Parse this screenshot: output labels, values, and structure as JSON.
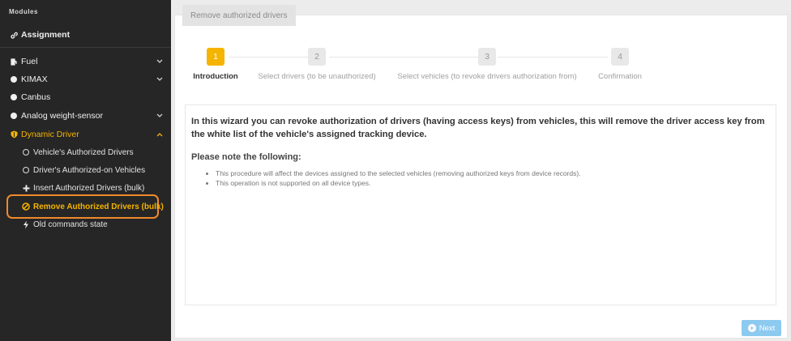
{
  "sidebar": {
    "header": "Modules",
    "assignment": "Assignment",
    "items": [
      {
        "label": "Fuel",
        "icon": "fuel-icon",
        "chevron": "down"
      },
      {
        "label": "KIMAX",
        "icon": "circle-icon",
        "chevron": "down"
      },
      {
        "label": "Canbus",
        "icon": "circle-icon"
      },
      {
        "label": "Analog weight-sensor",
        "icon": "circle-icon",
        "chevron": "down"
      },
      {
        "label": "Dynamic Driver",
        "icon": "shield-icon",
        "chevron": "up",
        "active": true
      }
    ],
    "subitems": [
      {
        "label": "Vehicle's Authorized Drivers",
        "icon": "ring-icon"
      },
      {
        "label": "Driver's Authorized-on Vehicles",
        "icon": "ring-icon"
      },
      {
        "label": "Insert Authorized Drivers (bulk)",
        "icon": "plus-icon"
      },
      {
        "label": "Remove Authorized Drivers (bulk)",
        "icon": "ban-icon",
        "highlighted": true
      },
      {
        "label": "Old commands state",
        "icon": "bolt-icon"
      }
    ]
  },
  "main": {
    "tab_label": "Remove authorized drivers",
    "steps": [
      {
        "num": "1",
        "label": "Introduction",
        "active": true
      },
      {
        "num": "2",
        "label": "Select drivers (to be unauthorized)"
      },
      {
        "num": "3",
        "label": "Select vehicles (to revoke drivers authorization from)"
      },
      {
        "num": "4",
        "label": "Confirmation"
      }
    ],
    "intro_text": "In this wizard you can revoke authorization of drivers (having access keys) from vehicles, this will remove the driver access key from the white list of the vehicle's assigned tracking device.",
    "note_heading": "Please note the following:",
    "bullets": [
      "This procedure will affect the devices assigned to the selected vehicles (removing authorized keys from device records).",
      "This operation is not supported on all device types."
    ],
    "next_label": "Next"
  },
  "colors": {
    "accent": "#f5b400",
    "highlight_border": "#f08a2c",
    "sidebar_bg": "#262626",
    "button": "#8dcaf0"
  }
}
